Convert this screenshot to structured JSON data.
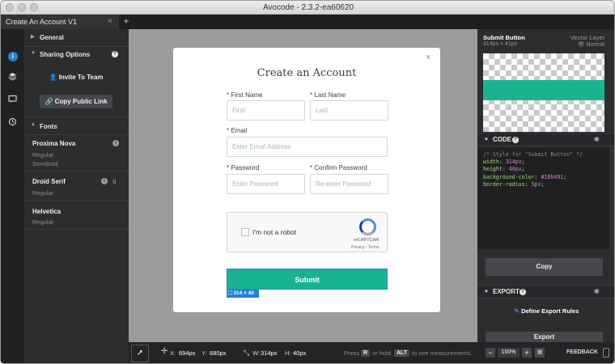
{
  "window": {
    "title": "Avocode - 2.3.2-ea60620"
  },
  "tabs": {
    "active": "Create An Account V1",
    "add": "+",
    "close": "×"
  },
  "iconbar": {
    "icons": [
      "info-icon",
      "layers-icon",
      "comments-icon",
      "history-icon"
    ]
  },
  "left": {
    "general": "General",
    "sharing": "Sharing Options",
    "invite": "Invite To Team",
    "copy_link": "Copy Public Link",
    "fonts": "Fonts",
    "font_list": [
      {
        "name": "Proxima Nova",
        "styles": [
          "Regular",
          "Semibold"
        ]
      },
      {
        "name": "Droid Serif",
        "styles": [
          "Regular"
        ]
      },
      {
        "name": "Helvetica",
        "styles": [
          "Regular"
        ]
      }
    ]
  },
  "modal": {
    "title": "Create an Account",
    "first_name_label": "First Name",
    "first_placeholder": "First",
    "last_name_label": "Last Name",
    "last_placeholder": "Last",
    "email_label": "Email",
    "email_placeholder": "Enter Email Address",
    "password_label": "Password",
    "password_placeholder": "Enter Password",
    "confirm_label": "Confirm Password",
    "confirm_placeholder": "Re-enter Password",
    "captcha_text": "I'm not a robot",
    "captcha_brand": "reCAPTCHA",
    "captcha_links": "Privacy - Terms",
    "submit": "Submit",
    "dims": "314 × 40",
    "close": "×"
  },
  "bottombar": {
    "x_label": "X:",
    "x_val": "694px",
    "y_label": "Y:",
    "y_val": "680px",
    "w_label": "W:",
    "w_val": "314px",
    "h_label": "H:",
    "h_val": "40px",
    "press": "Press",
    "key_r": "R",
    "or_hold": "or hold",
    "key_alt": "ALT",
    "to_see": "to see measurements."
  },
  "right": {
    "layer_name": "Submit Button",
    "layer_size": "314px × 41px",
    "layer_type": "Vector Layer",
    "blend": "Normal",
    "code_title": "CODE",
    "code_comment": "/* Style for \"Submit Button\" */",
    "code_lines": [
      {
        "prop": "width",
        "val": "314px"
      },
      {
        "prop": "height",
        "val": "40px"
      },
      {
        "prop": "background-color",
        "val": "#18b491"
      },
      {
        "prop": "border-radius",
        "val": "5px"
      }
    ],
    "copy": "Copy",
    "export_title": "EXPORT",
    "define": "Define Export Rules",
    "export_btn": "Export",
    "zoom": "100%",
    "minus": "−",
    "plus": "+",
    "feedback": "FEEDBACK"
  },
  "colors": {
    "accent": "#18b491",
    "selection": "#2a7fd7",
    "required": "#d0021b"
  }
}
